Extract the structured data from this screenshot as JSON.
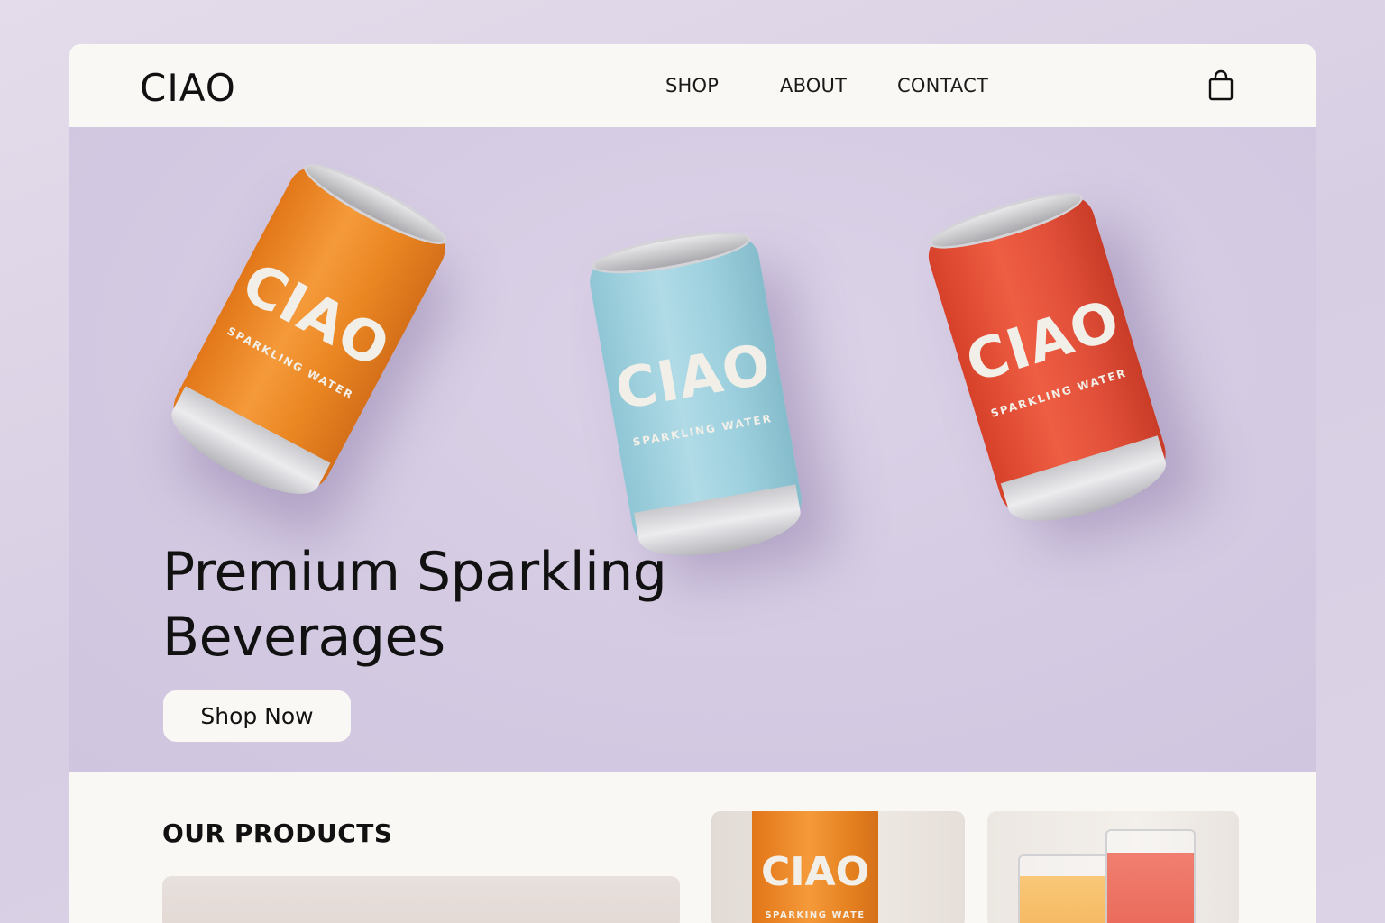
{
  "header": {
    "logo": "CIAO",
    "nav": [
      {
        "label": "SHOP"
      },
      {
        "label": "ABOUT"
      },
      {
        "label": "CONTACT"
      }
    ],
    "cart_icon": "shopping-bag-icon"
  },
  "hero": {
    "cans": [
      {
        "brand": "CIAO",
        "subtitle": "SPARKLING WATER",
        "color": "#f08a25"
      },
      {
        "brand": "CIAO",
        "subtitle": "SPARKLING WATER",
        "color": "#a3d3e0"
      },
      {
        "brand": "CIAO",
        "subtitle": "SPARKLING WATER",
        "color": "#e4503a"
      }
    ],
    "title_line1": "Premium Sparkling",
    "title_line2": "Beverages",
    "cta_label": "Shop Now"
  },
  "products": {
    "title": "OUR PRODUCTS",
    "card_can_brand": "CIAO",
    "card_can_subtitle": "SPARKING WATE"
  },
  "colors": {
    "background": "#d8cee4",
    "surface": "#faf8f4",
    "text": "#111111",
    "orange": "#f08a25",
    "blue": "#a3d3e0",
    "red": "#e4503a"
  }
}
